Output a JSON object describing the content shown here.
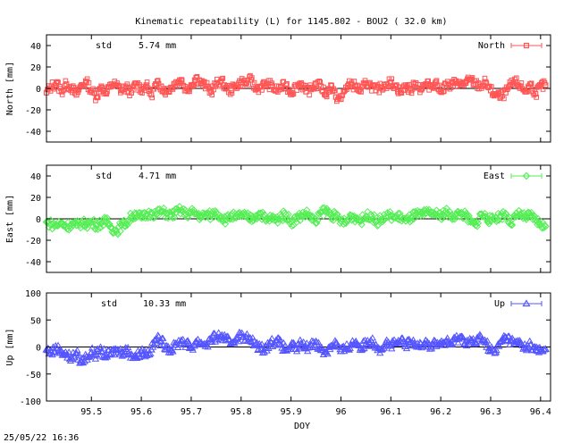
{
  "title": "Kinematic repeatability (L) for 1145.802 - BOU2  ( 32.0 km)",
  "timestamp": "25/05/22 16:36",
  "xlabel": "DOY",
  "colors": {
    "north": "#ff5555",
    "east": "#55ee55",
    "up": "#5555ff",
    "axis": "#000000"
  },
  "chart_data": [
    {
      "type": "scatter",
      "key": "north",
      "series_name": "North",
      "ylabel": "North [mm]",
      "std_label": "std",
      "std_value": "5.74 mm",
      "xlim": [
        95.41,
        96.42
      ],
      "ylim": [
        -50,
        50
      ],
      "yticks": [
        -40,
        -20,
        0,
        20,
        40
      ],
      "xticks": [],
      "marker": "square",
      "grid": false,
      "legend": "top-right",
      "x": [
        95.41,
        95.42,
        95.43,
        95.44,
        95.45,
        95.46,
        95.47,
        95.48,
        95.49,
        95.5,
        95.51,
        95.52,
        95.53,
        95.54,
        95.55,
        95.56,
        95.57,
        95.58,
        95.59,
        95.6,
        95.61,
        95.62,
        95.63,
        95.64,
        95.65,
        95.66,
        95.67,
        95.68,
        95.69,
        95.7,
        95.71,
        95.72,
        95.73,
        95.74,
        95.75,
        95.76,
        95.77,
        95.78,
        95.79,
        95.8,
        95.81,
        95.82,
        95.83,
        95.84,
        95.85,
        95.86,
        95.87,
        95.88,
        95.89,
        95.9,
        95.91,
        95.92,
        95.93,
        95.94,
        95.95,
        95.96,
        95.97,
        95.98,
        95.99,
        96.0,
        96.01,
        96.02,
        96.03,
        96.04,
        96.05,
        96.06,
        96.07,
        96.08,
        96.09,
        96.1,
        96.11,
        96.12,
        96.13,
        96.14,
        96.15,
        96.16,
        96.17,
        96.18,
        96.19,
        96.2,
        96.21,
        96.22,
        96.23,
        96.24,
        96.25,
        96.26,
        96.27,
        96.28,
        96.29,
        96.3,
        96.31,
        96.32,
        96.33,
        96.34,
        96.35,
        96.36,
        96.37,
        96.38,
        96.39,
        96.4,
        96.41
      ],
      "y": [
        -4,
        2,
        5,
        -3,
        4,
        1,
        -6,
        3,
        6,
        -2,
        -8,
        2,
        -5,
        4,
        3,
        -2,
        1,
        -4,
        5,
        -1,
        3,
        -6,
        4,
        2,
        -3,
        1,
        6,
        8,
        -2,
        3,
        10,
        5,
        2,
        -3,
        4,
        7,
        1,
        -2,
        3,
        6,
        5,
        8,
        -1,
        2,
        4,
        3,
        -2,
        1,
        3,
        -4,
        2,
        5,
        -3,
        -1,
        4,
        2,
        -6,
        3,
        -8,
        -10,
        1,
        4,
        2,
        -3,
        5,
        3,
        -2,
        1,
        4,
        6,
        2,
        -4,
        3,
        -2,
        5,
        -1,
        4,
        2,
        6,
        -3,
        4,
        1,
        7,
        3,
        5,
        8,
        4,
        2,
        6,
        -2,
        -6,
        -8,
        -4,
        3,
        6,
        2,
        -3,
        4,
        -5,
        2,
        3
      ]
    },
    {
      "type": "scatter",
      "key": "east",
      "series_name": "East",
      "ylabel": "East [mm]",
      "std_label": "std",
      "std_value": "4.71 mm",
      "xlim": [
        95.41,
        96.42
      ],
      "ylim": [
        -50,
        50
      ],
      "yticks": [
        -40,
        -20,
        0,
        20,
        40
      ],
      "xticks": [],
      "marker": "diamond",
      "grid": false,
      "legend": "top-right",
      "x": [
        95.41,
        95.42,
        95.43,
        95.44,
        95.45,
        95.46,
        95.47,
        95.48,
        95.49,
        95.5,
        95.51,
        95.52,
        95.53,
        95.54,
        95.55,
        95.56,
        95.57,
        95.58,
        95.59,
        95.6,
        95.61,
        95.62,
        95.63,
        95.64,
        95.65,
        95.66,
        95.67,
        95.68,
        95.69,
        95.7,
        95.71,
        95.72,
        95.73,
        95.74,
        95.75,
        95.76,
        95.77,
        95.78,
        95.79,
        95.8,
        95.81,
        95.82,
        95.83,
        95.84,
        95.85,
        95.86,
        95.87,
        95.88,
        95.89,
        95.9,
        95.91,
        95.92,
        95.93,
        95.94,
        95.95,
        95.96,
        95.97,
        95.98,
        95.99,
        96.0,
        96.01,
        96.02,
        96.03,
        96.04,
        96.05,
        96.06,
        96.07,
        96.08,
        96.09,
        96.1,
        96.11,
        96.12,
        96.13,
        96.14,
        96.15,
        96.16,
        96.17,
        96.18,
        96.19,
        96.2,
        96.21,
        96.22,
        96.23,
        96.24,
        96.25,
        96.26,
        96.27,
        96.28,
        96.29,
        96.3,
        96.31,
        96.32,
        96.33,
        96.34,
        96.35,
        96.36,
        96.37,
        96.38,
        96.39,
        96.4,
        96.41
      ],
      "y": [
        -3,
        -5,
        -6,
        -4,
        -7,
        -5,
        -6,
        -4,
        -5,
        -3,
        -6,
        -4,
        -2,
        -8,
        -12,
        -6,
        -4,
        2,
        5,
        1,
        3,
        6,
        4,
        7,
        5,
        3,
        6,
        8,
        4,
        6,
        5,
        2,
        4,
        3,
        6,
        2,
        -1,
        3,
        1,
        4,
        2,
        0,
        3,
        5,
        -2,
        1,
        -1,
        2,
        4,
        -3,
        0,
        3,
        5,
        2,
        -4,
        6,
        8,
        4,
        2,
        -2,
        -4,
        3,
        1,
        -2,
        2,
        4,
        -3,
        -1,
        2,
        3,
        1,
        2,
        -2,
        1,
        4,
        3,
        5,
        6,
        4,
        3,
        7,
        2,
        4,
        5,
        3,
        -3,
        -6,
        4,
        2,
        -2,
        1,
        3,
        5,
        -5,
        2,
        4,
        1,
        3,
        -1,
        -5,
        -7
      ]
    },
    {
      "type": "scatter",
      "key": "up",
      "series_name": "Up",
      "ylabel": "Up [mm]",
      "std_label": "std",
      "std_value": "10.33 mm",
      "xlim": [
        95.41,
        96.42
      ],
      "ylim": [
        -100,
        100
      ],
      "yticks": [
        -100,
        -50,
        0,
        50,
        100
      ],
      "xticks": [
        95.5,
        95.6,
        95.7,
        95.8,
        95.9,
        96,
        96.1,
        96.2,
        96.3,
        96.4
      ],
      "xticklabels": [
        "95.5",
        "95.6",
        "95.7",
        "95.8",
        "95.9",
        "96",
        "96.1",
        "96.2",
        "96.3",
        "96.4"
      ],
      "marker": "triangle",
      "grid": false,
      "legend": "top-right",
      "x": [
        95.41,
        95.42,
        95.43,
        95.44,
        95.45,
        95.46,
        95.47,
        95.48,
        95.49,
        95.5,
        95.51,
        95.52,
        95.53,
        95.54,
        95.55,
        95.56,
        95.57,
        95.58,
        95.59,
        95.6,
        95.61,
        95.62,
        95.63,
        95.64,
        95.65,
        95.66,
        95.67,
        95.68,
        95.69,
        95.7,
        95.71,
        95.72,
        95.73,
        95.74,
        95.75,
        95.76,
        95.77,
        95.78,
        95.79,
        95.8,
        95.81,
        95.82,
        95.83,
        95.84,
        95.85,
        95.86,
        95.87,
        95.88,
        95.89,
        95.9,
        95.91,
        95.92,
        95.93,
        95.94,
        95.95,
        95.96,
        95.97,
        95.98,
        95.99,
        96.0,
        96.01,
        96.02,
        96.03,
        96.04,
        96.05,
        96.06,
        96.07,
        96.08,
        96.09,
        96.1,
        96.11,
        96.12,
        96.13,
        96.14,
        96.15,
        96.16,
        96.17,
        96.18,
        96.19,
        96.2,
        96.21,
        96.22,
        96.23,
        96.24,
        96.25,
        96.26,
        96.27,
        96.28,
        96.29,
        96.3,
        96.31,
        96.32,
        96.33,
        96.34,
        96.35,
        96.36,
        96.37,
        96.38,
        96.39,
        96.4,
        96.41
      ],
      "y": [
        -5,
        -10,
        -2,
        -8,
        -15,
        -20,
        -12,
        -28,
        -18,
        -10,
        -14,
        -8,
        -16,
        -12,
        -6,
        -10,
        -4,
        -14,
        -18,
        -8,
        -12,
        -5,
        15,
        10,
        2,
        -6,
        4,
        12,
        6,
        -2,
        10,
        8,
        4,
        14,
        18,
        20,
        12,
        8,
        16,
        22,
        18,
        10,
        6,
        -4,
        0,
        8,
        12,
        4,
        -6,
        2,
        -4,
        6,
        -2,
        4,
        10,
        -6,
        -10,
        2,
        8,
        -8,
        -4,
        4,
        10,
        -2,
        6,
        12,
        4,
        -4,
        8,
        2,
        6,
        10,
        4,
        8,
        2,
        6,
        12,
        0,
        8,
        6,
        10,
        4,
        14,
        18,
        10,
        12,
        6,
        20,
        8,
        -6,
        -10,
        10,
        18,
        12,
        6,
        8,
        -2,
        4,
        -6,
        -8,
        -4
      ]
    }
  ]
}
